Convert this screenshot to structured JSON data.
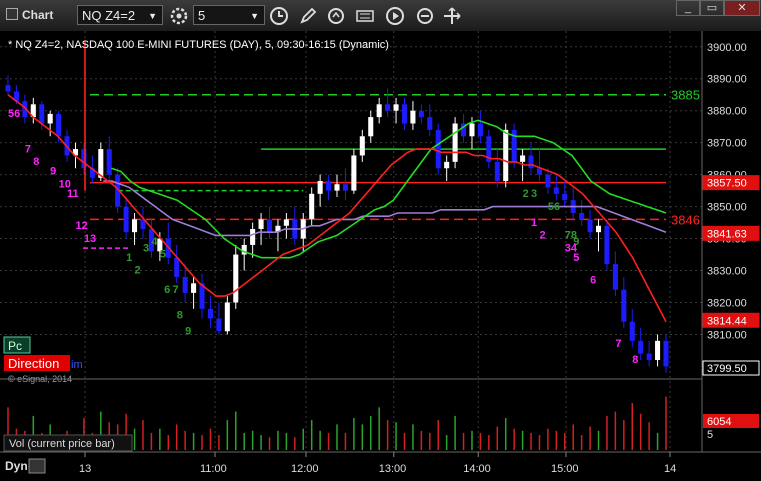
{
  "window": {
    "title": "Chart",
    "symbol": "NQ Z4=2",
    "interval": "5",
    "buttons": [
      "minimize",
      "restore",
      "close"
    ]
  },
  "chart_info": {
    "description": "* NQ Z4=2, NASDAQ 100 E-MINI FUTURES (DAY), 5, 09:30-16:15 (Dynamic)",
    "copyright": "© eSignal, 2014"
  },
  "overlays": {
    "pc_label": "Pc",
    "direction_label": "Direction",
    "direction_suffix": "im",
    "vol_label": "Vol (current price bar)",
    "dyn_label": "Dyn"
  },
  "price_tags": {
    "resistance_green": "3885",
    "resistance_red": "3846",
    "red_ma": "3857.50",
    "ma_fast": "3841.63",
    "last_red": "3814.44",
    "last_price": "3799.50",
    "volume": "6054"
  },
  "colors": {
    "up_candle": "#ffffff",
    "down_candle": "#1c1cff",
    "red_ma": "#ff2020",
    "green_ma": "#22dd22",
    "purple_ma": "#9d7dd6",
    "count_magenta": "#ff22ff",
    "count_green": "#2e9a2e",
    "green_level": "#22cc22",
    "red_level": "#ff2020"
  },
  "chart_data": {
    "type": "candlestick",
    "price_axis_ticks": [
      "3900.00",
      "3890.00",
      "3880.00",
      "3870.00",
      "3860.00",
      "3850.00",
      "3840.00",
      "3830.00",
      "3820.00",
      "3810.00"
    ],
    "volume_axis_ticks": [
      "5"
    ],
    "time_axis_ticks": [
      "13",
      "11:00",
      "12:00",
      "13:00",
      "14:00",
      "15:00",
      "14"
    ],
    "ylim": [
      3797,
      3904
    ],
    "levels": [
      {
        "value": 3885,
        "color": "green",
        "dash": "long"
      },
      {
        "value": 3868,
        "color": "green",
        "dash": "solid",
        "from": 3
      },
      {
        "value": 3855,
        "color": "green",
        "dash": "short",
        "to": 5.5
      },
      {
        "value": 3857.5,
        "color": "red",
        "dash": "solid"
      },
      {
        "value": 3846,
        "color": "red",
        "dash": "long"
      }
    ],
    "candles": [
      {
        "o": 3888,
        "h": 3891,
        "l": 3885,
        "c": 3886
      },
      {
        "o": 3886,
        "h": 3888,
        "l": 3882,
        "c": 3883
      },
      {
        "o": 3883,
        "h": 3885,
        "l": 3876,
        "c": 3878
      },
      {
        "o": 3878,
        "h": 3884,
        "l": 3876,
        "c": 3882
      },
      {
        "o": 3882,
        "h": 3883,
        "l": 3874,
        "c": 3876
      },
      {
        "o": 3876,
        "h": 3880,
        "l": 3872,
        "c": 3879
      },
      {
        "o": 3879,
        "h": 3880,
        "l": 3870,
        "c": 3872
      },
      {
        "o": 3872,
        "h": 3874,
        "l": 3864,
        "c": 3866
      },
      {
        "o": 3866,
        "h": 3870,
        "l": 3862,
        "c": 3868
      },
      {
        "o": 3868,
        "h": 3870,
        "l": 3860,
        "c": 3862
      },
      {
        "o": 3862,
        "h": 3866,
        "l": 3857,
        "c": 3859
      },
      {
        "o": 3859,
        "h": 3870,
        "l": 3858,
        "c": 3868
      },
      {
        "o": 3868,
        "h": 3872,
        "l": 3858,
        "c": 3860
      },
      {
        "o": 3860,
        "h": 3862,
        "l": 3848,
        "c": 3850
      },
      {
        "o": 3850,
        "h": 3853,
        "l": 3840,
        "c": 3842
      },
      {
        "o": 3842,
        "h": 3848,
        "l": 3838,
        "c": 3846
      },
      {
        "o": 3846,
        "h": 3850,
        "l": 3840,
        "c": 3843
      },
      {
        "o": 3843,
        "h": 3846,
        "l": 3834,
        "c": 3836
      },
      {
        "o": 3836,
        "h": 3842,
        "l": 3833,
        "c": 3840
      },
      {
        "o": 3840,
        "h": 3845,
        "l": 3832,
        "c": 3834
      },
      {
        "o": 3834,
        "h": 3838,
        "l": 3826,
        "c": 3828
      },
      {
        "o": 3828,
        "h": 3832,
        "l": 3820,
        "c": 3823
      },
      {
        "o": 3823,
        "h": 3828,
        "l": 3818,
        "c": 3826
      },
      {
        "o": 3826,
        "h": 3829,
        "l": 3815,
        "c": 3818
      },
      {
        "o": 3818,
        "h": 3822,
        "l": 3812,
        "c": 3815
      },
      {
        "o": 3815,
        "h": 3820,
        "l": 3810,
        "c": 3811
      },
      {
        "o": 3811,
        "h": 3822,
        "l": 3810,
        "c": 3820
      },
      {
        "o": 3820,
        "h": 3838,
        "l": 3818,
        "c": 3835
      },
      {
        "o": 3835,
        "h": 3840,
        "l": 3830,
        "c": 3838
      },
      {
        "o": 3838,
        "h": 3845,
        "l": 3834,
        "c": 3843
      },
      {
        "o": 3843,
        "h": 3848,
        "l": 3838,
        "c": 3846
      },
      {
        "o": 3846,
        "h": 3850,
        "l": 3840,
        "c": 3842
      },
      {
        "o": 3842,
        "h": 3846,
        "l": 3836,
        "c": 3844
      },
      {
        "o": 3844,
        "h": 3848,
        "l": 3840,
        "c": 3846
      },
      {
        "o": 3846,
        "h": 3850,
        "l": 3838,
        "c": 3840
      },
      {
        "o": 3840,
        "h": 3848,
        "l": 3836,
        "c": 3846
      },
      {
        "o": 3846,
        "h": 3856,
        "l": 3844,
        "c": 3854
      },
      {
        "o": 3854,
        "h": 3860,
        "l": 3850,
        "c": 3858
      },
      {
        "o": 3858,
        "h": 3860,
        "l": 3852,
        "c": 3855
      },
      {
        "o": 3855,
        "h": 3860,
        "l": 3853,
        "c": 3857
      },
      {
        "o": 3857,
        "h": 3862,
        "l": 3852,
        "c": 3855
      },
      {
        "o": 3855,
        "h": 3868,
        "l": 3854,
        "c": 3866
      },
      {
        "o": 3866,
        "h": 3874,
        "l": 3864,
        "c": 3872
      },
      {
        "o": 3872,
        "h": 3880,
        "l": 3870,
        "c": 3878
      },
      {
        "o": 3878,
        "h": 3884,
        "l": 3876,
        "c": 3882
      },
      {
        "o": 3882,
        "h": 3887,
        "l": 3878,
        "c": 3880
      },
      {
        "o": 3880,
        "h": 3884,
        "l": 3876,
        "c": 3882
      },
      {
        "o": 3882,
        "h": 3884,
        "l": 3874,
        "c": 3876
      },
      {
        "o": 3876,
        "h": 3883,
        "l": 3874,
        "c": 3880
      },
      {
        "o": 3880,
        "h": 3882,
        "l": 3876,
        "c": 3878
      },
      {
        "o": 3878,
        "h": 3882,
        "l": 3872,
        "c": 3874
      },
      {
        "o": 3874,
        "h": 3876,
        "l": 3860,
        "c": 3862
      },
      {
        "o": 3862,
        "h": 3866,
        "l": 3858,
        "c": 3864
      },
      {
        "o": 3864,
        "h": 3878,
        "l": 3862,
        "c": 3876
      },
      {
        "o": 3876,
        "h": 3879,
        "l": 3870,
        "c": 3872
      },
      {
        "o": 3872,
        "h": 3878,
        "l": 3868,
        "c": 3876
      },
      {
        "o": 3876,
        "h": 3880,
        "l": 3870,
        "c": 3872
      },
      {
        "o": 3872,
        "h": 3874,
        "l": 3862,
        "c": 3864
      },
      {
        "o": 3864,
        "h": 3868,
        "l": 3856,
        "c": 3858
      },
      {
        "o": 3858,
        "h": 3876,
        "l": 3856,
        "c": 3874
      },
      {
        "o": 3874,
        "h": 3876,
        "l": 3862,
        "c": 3864
      },
      {
        "o": 3864,
        "h": 3868,
        "l": 3858,
        "c": 3866
      },
      {
        "o": 3866,
        "h": 3870,
        "l": 3860,
        "c": 3862
      },
      {
        "o": 3862,
        "h": 3868,
        "l": 3858,
        "c": 3860
      },
      {
        "o": 3860,
        "h": 3862,
        "l": 3854,
        "c": 3856
      },
      {
        "o": 3856,
        "h": 3860,
        "l": 3852,
        "c": 3854
      },
      {
        "o": 3854,
        "h": 3858,
        "l": 3850,
        "c": 3852
      },
      {
        "o": 3852,
        "h": 3856,
        "l": 3846,
        "c": 3848
      },
      {
        "o": 3848,
        "h": 3852,
        "l": 3844,
        "c": 3846
      },
      {
        "o": 3846,
        "h": 3849,
        "l": 3840,
        "c": 3842
      },
      {
        "o": 3842,
        "h": 3846,
        "l": 3836,
        "c": 3844
      },
      {
        "o": 3844,
        "h": 3846,
        "l": 3830,
        "c": 3832
      },
      {
        "o": 3832,
        "h": 3836,
        "l": 3822,
        "c": 3824
      },
      {
        "o": 3824,
        "h": 3828,
        "l": 3812,
        "c": 3814
      },
      {
        "o": 3814,
        "h": 3818,
        "l": 3806,
        "c": 3808
      },
      {
        "o": 3808,
        "h": 3812,
        "l": 3802,
        "c": 3804
      },
      {
        "o": 3804,
        "h": 3808,
        "l": 3800,
        "c": 3802
      },
      {
        "o": 3802,
        "h": 3810,
        "l": 3800,
        "c": 3808
      },
      {
        "o": 3808,
        "h": 3810,
        "l": 3798,
        "c": 3800
      }
    ],
    "volume": [
      20,
      10,
      9,
      16,
      8,
      12,
      7,
      9,
      7,
      15,
      8,
      18,
      13,
      12,
      17,
      10,
      14,
      8,
      10,
      7,
      12,
      9,
      8,
      7,
      10,
      7,
      14,
      18,
      8,
      9,
      7,
      6,
      9,
      8,
      6,
      10,
      14,
      9,
      8,
      12,
      8,
      15,
      12,
      16,
      20,
      14,
      13,
      8,
      12,
      9,
      8,
      14,
      7,
      16,
      8,
      9,
      8,
      7,
      11,
      15,
      10,
      9,
      8,
      7,
      10,
      9,
      8,
      12,
      7,
      11,
      9,
      16,
      18,
      14,
      22,
      17,
      13,
      8,
      25
    ],
    "red_ma": [
      3885,
      3883,
      3881,
      3878,
      3876,
      3874,
      3872,
      3869,
      3866,
      3864,
      3862,
      3860,
      3858,
      3856,
      3853,
      3850,
      3847,
      3844,
      3841,
      3838,
      3835,
      3832,
      3829,
      3826,
      3824,
      3822,
      3822,
      3823,
      3825,
      3827,
      3829,
      3831,
      3833,
      3835,
      3836,
      3837,
      3838,
      3840,
      3842,
      3844,
      3846,
      3848,
      3851,
      3854,
      3857,
      3860,
      3863,
      3865,
      3867,
      3868,
      3868,
      3868,
      3867,
      3867,
      3867,
      3867,
      3866,
      3866,
      3865,
      3865,
      3864,
      3864,
      3863,
      3863,
      3862,
      3861,
      3860,
      3858,
      3856,
      3854,
      3851,
      3848,
      3845,
      3842,
      3838,
      3834,
      3829,
      3824,
      3819,
      3814
    ],
    "green_ma": [
      null,
      null,
      null,
      null,
      null,
      null,
      null,
      null,
      null,
      null,
      null,
      3862,
      3861,
      3858,
      3856,
      3855,
      3854,
      3853,
      3852,
      3850,
      3848,
      3846,
      3843,
      3840,
      3838,
      3836,
      3835,
      3834,
      3834,
      3834,
      3834,
      3835,
      3837,
      3839,
      3840,
      3841,
      3843,
      3845,
      3847,
      3849,
      3850,
      3852,
      3856,
      3860,
      3864,
      3868,
      3870,
      3872,
      3874,
      3876,
      3877,
      3876,
      3875,
      3873,
      3872,
      3872,
      3872,
      3871,
      3870,
      3868,
      3866,
      3862,
      3858,
      3856,
      3854,
      3853,
      3852,
      3851,
      3850,
      3849,
      3848
    ],
    "purple_ma": [
      null,
      null,
      null,
      null,
      null,
      null,
      null,
      null,
      null,
      null,
      null,
      3858,
      3858,
      3857,
      3856,
      3854,
      3852,
      3850,
      3848,
      3846,
      3845,
      3844,
      3843,
      3842,
      3841,
      3841,
      3841,
      3841,
      3841,
      3842,
      3842,
      3842,
      3843,
      3843,
      3843,
      3844,
      3844,
      3845,
      3846,
      3846,
      3846,
      3847,
      3847,
      3847,
      3847,
      3848,
      3848,
      3848,
      3848,
      3848,
      3849,
      3849,
      3849,
      3849,
      3849,
      3849,
      3850,
      3850,
      3850,
      3850,
      3850,
      3850,
      3850,
      3850,
      3850,
      3850,
      3850,
      3850,
      3850,
      3849,
      3848,
      3847,
      3846,
      3845,
      3844,
      3843,
      3842
    ],
    "annotations": [
      {
        "text": "56",
        "x": 0,
        "y": 3878,
        "color": "magenta"
      },
      {
        "text": "7",
        "x": 2,
        "y": 3867,
        "color": "magenta"
      },
      {
        "text": "8",
        "x": 3,
        "y": 3863,
        "color": "magenta"
      },
      {
        "text": "9",
        "x": 5,
        "y": 3860,
        "color": "magenta"
      },
      {
        "text": "10",
        "x": 6,
        "y": 3856,
        "color": "magenta"
      },
      {
        "text": "11",
        "x": 7,
        "y": 3853,
        "color": "magenta"
      },
      {
        "text": "12",
        "x": 8,
        "y": 3843,
        "color": "magenta"
      },
      {
        "text": "13",
        "x": 9,
        "y": 3839,
        "color": "magenta"
      },
      {
        "text": "1",
        "x": 14,
        "y": 3833,
        "color": "green"
      },
      {
        "text": "2",
        "x": 15,
        "y": 3829,
        "color": "green"
      },
      {
        "text": "3",
        "x": 16,
        "y": 3836,
        "color": "green"
      },
      {
        "text": "4",
        "x": 17,
        "y": 3838,
        "color": "green"
      },
      {
        "text": "5",
        "x": 18,
        "y": 3834,
        "color": "green"
      },
      {
        "text": "6",
        "x": 18.5,
        "y": 3823,
        "color": "green"
      },
      {
        "text": "7",
        "x": 19.5,
        "y": 3823,
        "color": "green"
      },
      {
        "text": "8",
        "x": 20,
        "y": 3815,
        "color": "green"
      },
      {
        "text": "9",
        "x": 21,
        "y": 3810,
        "color": "green"
      },
      {
        "text": "2",
        "x": 61,
        "y": 3853,
        "color": "green"
      },
      {
        "text": "3",
        "x": 62,
        "y": 3853,
        "color": "green"
      },
      {
        "text": "56",
        "x": 64,
        "y": 3849,
        "color": "green"
      },
      {
        "text": "1",
        "x": 62,
        "y": 3844,
        "color": "magenta"
      },
      {
        "text": "2",
        "x": 63,
        "y": 3840,
        "color": "magenta"
      },
      {
        "text": "78",
        "x": 66,
        "y": 3840,
        "color": "green"
      },
      {
        "text": "9",
        "x": 67,
        "y": 3838,
        "color": "green"
      },
      {
        "text": "34",
        "x": 66,
        "y": 3836,
        "color": "magenta"
      },
      {
        "text": "5",
        "x": 67,
        "y": 3833,
        "color": "magenta"
      },
      {
        "text": "6",
        "x": 69,
        "y": 3826,
        "color": "magenta"
      },
      {
        "text": "7",
        "x": 72,
        "y": 3806,
        "color": "magenta"
      },
      {
        "text": "8",
        "x": 74,
        "y": 3801,
        "color": "magenta"
      }
    ]
  }
}
